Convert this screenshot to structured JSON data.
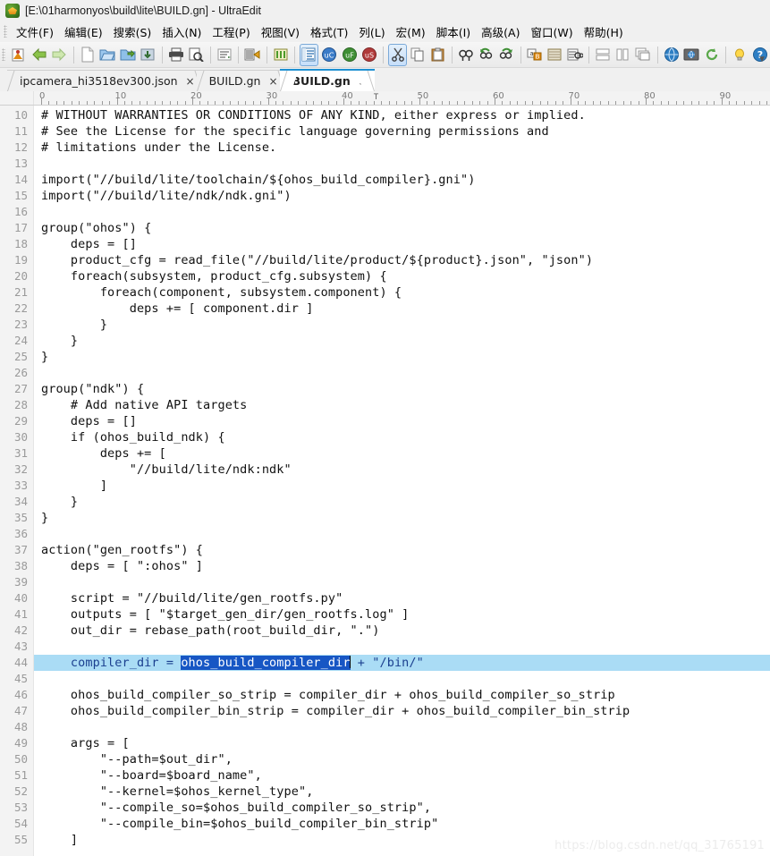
{
  "window": {
    "title": "[E:\\01harmonyos\\build\\lite\\BUILD.gn] - UltraEdit",
    "app_icon": "ultraedit-app-icon"
  },
  "menubar": {
    "items": [
      {
        "label": "文件(F)",
        "name": "menu-file"
      },
      {
        "label": "编辑(E)",
        "name": "menu-edit"
      },
      {
        "label": "搜索(S)",
        "name": "menu-search"
      },
      {
        "label": "插入(N)",
        "name": "menu-insert"
      },
      {
        "label": "工程(P)",
        "name": "menu-project"
      },
      {
        "label": "视图(V)",
        "name": "menu-view"
      },
      {
        "label": "格式(T)",
        "name": "menu-format"
      },
      {
        "label": "列(L)",
        "name": "menu-column"
      },
      {
        "label": "宏(M)",
        "name": "menu-macro"
      },
      {
        "label": "脚本(I)",
        "name": "menu-script"
      },
      {
        "label": "高级(A)",
        "name": "menu-advanced"
      },
      {
        "label": "窗口(W)",
        "name": "menu-window"
      },
      {
        "label": "帮助(H)",
        "name": "menu-help"
      }
    ]
  },
  "toolbar": {
    "overflow_label": "▼",
    "buttons": [
      {
        "icon": "new-project-icon",
        "active": false
      },
      {
        "icon": "back-arrow-icon",
        "active": false
      },
      {
        "icon": "forward-arrow-icon",
        "active": false
      },
      {
        "sep": true
      },
      {
        "icon": "new-file-icon",
        "active": false
      },
      {
        "icon": "open-file-icon",
        "active": false
      },
      {
        "icon": "open-folder-icon",
        "active": false
      },
      {
        "icon": "save-file-icon",
        "active": false
      },
      {
        "sep": true
      },
      {
        "icon": "print-icon",
        "active": false
      },
      {
        "icon": "print-preview-icon",
        "active": false
      },
      {
        "sep": true
      },
      {
        "icon": "word-wrap-icon",
        "active": false
      },
      {
        "sep": true
      },
      {
        "icon": "hex-edit-icon",
        "active": false
      },
      {
        "sep": true
      },
      {
        "icon": "column-mode-icon",
        "active": false
      },
      {
        "sep": true
      },
      {
        "icon": "line-numbers-icon",
        "active": true
      },
      {
        "icon": "uc-badge-icon",
        "active": false
      },
      {
        "icon": "uf-badge-icon",
        "active": false
      },
      {
        "icon": "us-badge-icon",
        "active": false
      },
      {
        "sep": true
      },
      {
        "icon": "cut-icon",
        "active": true
      },
      {
        "icon": "copy-icon",
        "active": false
      },
      {
        "icon": "paste-icon",
        "active": false
      },
      {
        "sep": true
      },
      {
        "icon": "find-icon",
        "active": false
      },
      {
        "icon": "find-previous-icon",
        "active": false
      },
      {
        "icon": "find-next-icon",
        "active": false
      },
      {
        "sep": true
      },
      {
        "icon": "replace-icon",
        "active": false
      },
      {
        "icon": "find-in-files-icon",
        "active": false
      },
      {
        "icon": "replace-in-files-icon",
        "active": false
      },
      {
        "sep": true
      },
      {
        "icon": "tile-horizontal-icon",
        "active": false
      },
      {
        "icon": "tile-vertical-icon",
        "active": false
      },
      {
        "icon": "cascade-windows-icon",
        "active": false
      },
      {
        "sep": true
      },
      {
        "icon": "browser-view-icon",
        "active": false
      },
      {
        "icon": "ftp-browser-icon",
        "active": false
      },
      {
        "icon": "refresh-icon",
        "active": false
      },
      {
        "sep": true
      },
      {
        "icon": "tip-of-day-icon",
        "active": false
      },
      {
        "icon": "help-icon",
        "active": false
      }
    ]
  },
  "tabs": [
    {
      "label": "ipcamera_hi3518ev300.json",
      "close": "×",
      "active": false
    },
    {
      "label": "BUILD.gn",
      "close": "×",
      "active": false
    },
    {
      "label": "BUILD.gn",
      "close": "×",
      "active": true
    }
  ],
  "ruler": {
    "numbers": [
      "0",
      "10",
      "20",
      "30",
      "40",
      "50",
      "60",
      "70",
      "80",
      "90"
    ],
    "tab_marker": "T"
  },
  "editor": {
    "first_line_number": 10,
    "highlight_line_number": 44,
    "selection_text": "ohos_build_compiler_dir",
    "lines": [
      {
        "n": "10",
        "text": "# WITHOUT WARRANTIES OR CONDITIONS OF ANY KIND, either express or implied."
      },
      {
        "n": "11",
        "text": "# See the License for the specific language governing permissions and"
      },
      {
        "n": "12",
        "text": "# limitations under the License."
      },
      {
        "n": "13",
        "text": ""
      },
      {
        "n": "14",
        "text": "import(\"//build/lite/toolchain/${ohos_build_compiler}.gni\")"
      },
      {
        "n": "15",
        "text": "import(\"//build/lite/ndk/ndk.gni\")"
      },
      {
        "n": "16",
        "text": ""
      },
      {
        "n": "17",
        "text": "group(\"ohos\") {"
      },
      {
        "n": "18",
        "text": "    deps = []"
      },
      {
        "n": "19",
        "text": "    product_cfg = read_file(\"//build/lite/product/${product}.json\", \"json\")"
      },
      {
        "n": "20",
        "text": "    foreach(subsystem, product_cfg.subsystem) {"
      },
      {
        "n": "21",
        "text": "        foreach(component, subsystem.component) {"
      },
      {
        "n": "22",
        "text": "            deps += [ component.dir ]"
      },
      {
        "n": "23",
        "text": "        }"
      },
      {
        "n": "24",
        "text": "    }"
      },
      {
        "n": "25",
        "text": "}"
      },
      {
        "n": "26",
        "text": ""
      },
      {
        "n": "27",
        "text": "group(\"ndk\") {"
      },
      {
        "n": "28",
        "text": "    # Add native API targets"
      },
      {
        "n": "29",
        "text": "    deps = []"
      },
      {
        "n": "30",
        "text": "    if (ohos_build_ndk) {"
      },
      {
        "n": "31",
        "text": "        deps += ["
      },
      {
        "n": "32",
        "text": "            \"//build/lite/ndk:ndk\""
      },
      {
        "n": "33",
        "text": "        ]"
      },
      {
        "n": "34",
        "text": "    }"
      },
      {
        "n": "35",
        "text": "}"
      },
      {
        "n": "36",
        "text": ""
      },
      {
        "n": "37",
        "text": "action(\"gen_rootfs\") {"
      },
      {
        "n": "38",
        "text": "    deps = [ \":ohos\" ]"
      },
      {
        "n": "39",
        "text": ""
      },
      {
        "n": "40",
        "text": "    script = \"//build/lite/gen_rootfs.py\""
      },
      {
        "n": "41",
        "text": "    outputs = [ \"$target_gen_dir/gen_rootfs.log\" ]"
      },
      {
        "n": "42",
        "text": "    out_dir = rebase_path(root_build_dir, \".\")"
      },
      {
        "n": "43",
        "text": ""
      },
      {
        "n": "44",
        "highlight": true,
        "pre": "    compiler_dir = ",
        "selected": "ohos_build_compiler_dir",
        "post": " + \"/bin/\""
      },
      {
        "n": "45",
        "text": ""
      },
      {
        "n": "46",
        "text": "    ohos_build_compiler_so_strip = compiler_dir + ohos_build_compiler_so_strip"
      },
      {
        "n": "47",
        "text": "    ohos_build_compiler_bin_strip = compiler_dir + ohos_build_compiler_bin_strip"
      },
      {
        "n": "48",
        "text": ""
      },
      {
        "n": "49",
        "text": "    args = ["
      },
      {
        "n": "50",
        "text": "        \"--path=$out_dir\","
      },
      {
        "n": "51",
        "text": "        \"--board=$board_name\","
      },
      {
        "n": "52",
        "text": "        \"--kernel=$ohos_kernel_type\","
      },
      {
        "n": "53",
        "text": "        \"--compile_so=$ohos_build_compiler_so_strip\","
      },
      {
        "n": "54",
        "text": "        \"--compile_bin=$ohos_build_compiler_bin_strip\""
      },
      {
        "n": "55",
        "text": "    ]"
      }
    ]
  },
  "watermark": {
    "text": "https://blog.csdn.net/qq_31765191"
  },
  "colors": {
    "highlight_line_bg": "#aadcf5",
    "selection_bg": "#1756c4",
    "highlight_text": "#1a3f8f",
    "active_tab_accent": "#1e90d2",
    "toolbar_active_border": "#7aa9d8"
  }
}
